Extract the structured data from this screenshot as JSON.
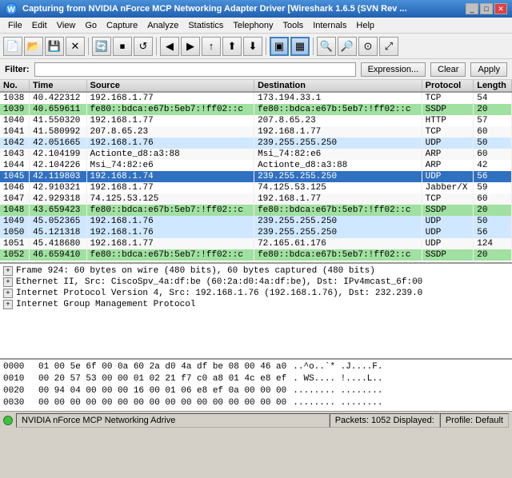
{
  "window": {
    "title": "Capturing from NVIDIA nForce MCP Networking Adapter Driver   [Wireshark 1.6.5  (SVN Rev ..."
  },
  "menu": {
    "items": [
      "File",
      "Edit",
      "View",
      "Go",
      "Capture",
      "Analyze",
      "Statistics",
      "Telephony",
      "Tools",
      "Internals",
      "Help"
    ]
  },
  "filter": {
    "label": "Filter:",
    "value": "",
    "placeholder": "",
    "expression_btn": "Expression...",
    "clear_btn": "Clear",
    "apply_btn": "Apply"
  },
  "columns": [
    "No.",
    "Time",
    "Source",
    "Destination",
    "Protocol",
    "Length"
  ],
  "packets": [
    {
      "no": "1038",
      "time": "40.422312",
      "src": "192.168.1.77",
      "dst": "173.194.33.1",
      "proto": "TCP",
      "len": "54",
      "style": "normal"
    },
    {
      "no": "1039",
      "time": "40.659611",
      "src": "fe80::bdca:e67b:5eb7:!ff02::c",
      "dst": "fe80::bdca:e67b:5eb7:!ff02::c",
      "proto": "SSDP",
      "len": "20",
      "style": "green"
    },
    {
      "no": "1040",
      "time": "41.550320",
      "src": "192.168.1.77",
      "dst": "207.8.65.23",
      "proto": "HTTP",
      "len": "57",
      "style": "normal"
    },
    {
      "no": "1041",
      "time": "41.580992",
      "src": "207.8.65.23",
      "dst": "192.168.1.77",
      "proto": "TCP",
      "len": "60",
      "style": "normal"
    },
    {
      "no": "1042",
      "time": "42.051665",
      "src": "192.168.1.76",
      "dst": "239.255.255.250",
      "proto": "UDP",
      "len": "50",
      "style": "lightblue"
    },
    {
      "no": "1043",
      "time": "42.104199",
      "src": "Actionte_d8:a3:88",
      "dst": "Msi_74:82:e6",
      "proto": "ARP",
      "len": "60",
      "style": "normal"
    },
    {
      "no": "1044",
      "time": "42.104226",
      "src": "Msi_74:82:e6",
      "dst": "Actionte_d8:a3:88",
      "proto": "ARP",
      "len": "42",
      "style": "normal"
    },
    {
      "no": "1045",
      "time": "42.119803",
      "src": "192.168.1.74",
      "dst": "239.255.255.250",
      "proto": "UDP",
      "len": "56",
      "style": "selected"
    },
    {
      "no": "1046",
      "time": "42.910321",
      "src": "192.168.1.77",
      "dst": "74.125.53.125",
      "proto": "Jabber/X",
      "len": "59",
      "style": "normal"
    },
    {
      "no": "1047",
      "time": "42.929318",
      "src": "74.125.53.125",
      "dst": "192.168.1.77",
      "proto": "TCP",
      "len": "60",
      "style": "normal"
    },
    {
      "no": "1048",
      "time": "43.659423",
      "src": "fe80::bdca:e67b:5eb7:!ff02::c",
      "dst": "fe80::bdca:e67b:5eb7:!ff02::c",
      "proto": "SSDP",
      "len": "20",
      "style": "green"
    },
    {
      "no": "1049",
      "time": "45.052365",
      "src": "192.168.1.76",
      "dst": "239.255.255.250",
      "proto": "UDP",
      "len": "50",
      "style": "lightblue"
    },
    {
      "no": "1050",
      "time": "45.121318",
      "src": "192.168.1.76",
      "dst": "239.255.255.250",
      "proto": "UDP",
      "len": "56",
      "style": "lightblue"
    },
    {
      "no": "1051",
      "time": "45.418680",
      "src": "192.168.1.77",
      "dst": "72.165.61.176",
      "proto": "UDP",
      "len": "124",
      "style": "normal"
    },
    {
      "no": "1052",
      "time": "46.659410",
      "src": "fe80::bdca:e67b:5eb7:!ff02::c",
      "dst": "fe80::bdca:e67b:5eb7:!ff02::c",
      "proto": "SSDP",
      "len": "20",
      "style": "green"
    }
  ],
  "detail": {
    "items": [
      "Frame 924: 60 bytes on wire (480 bits), 60 bytes captured (480 bits)",
      "Ethernet II, Src: CiscoSpv_4a:df:be (60:2a:d0:4a:df:be), Dst: IPv4mcast_6f:00",
      "Internet Protocol Version 4, Src: 192.168.1.76 (192.168.1.76), Dst: 232.239.0",
      "Internet Group Management Protocol"
    ]
  },
  "hex": {
    "lines": [
      {
        "offset": "0000",
        "bytes": "01 00 5e 6f 00 0a 60 2a  d0 4a df be 08 00 46 a0",
        "ascii": "..^o..`* .J....F."
      },
      {
        "offset": "0010",
        "bytes": "00 20 57 53 00 00 01 02  21 f7 c0 a8 01 4c e8 ef",
        "ascii": ". WS.... !....L.."
      },
      {
        "offset": "0020",
        "bytes": "00 94 04 00 00 00 16 00  01 06 e8 ef 0a 00 00 00",
        "ascii": "........ ........"
      },
      {
        "offset": "0030",
        "bytes": "00 00 00 00 00 00 00 00  00 00 00 00 00 00 00 00",
        "ascii": "........ ........"
      }
    ]
  },
  "status": {
    "adapter": "NVIDIA nForce MCP Networking Adrive",
    "packets": "Packets: 1052 Displayed:",
    "profile": "Profile: Default"
  }
}
